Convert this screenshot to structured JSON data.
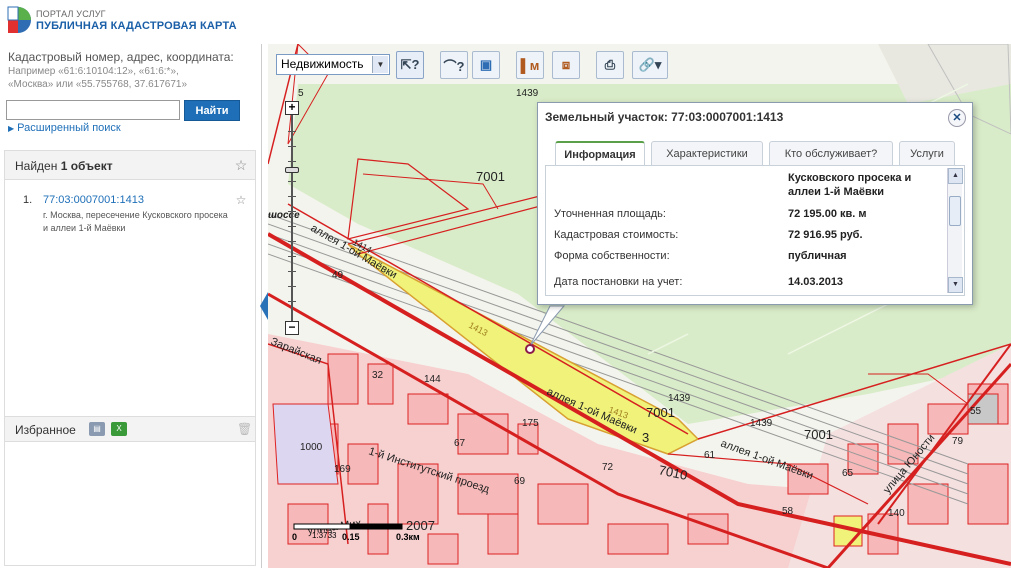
{
  "header": {
    "portal_title": "ПОРТАЛ УСЛУГ",
    "portal_subtitle": "ПУБЛИЧНАЯ КАДАСТРОВАЯ КАРТА"
  },
  "search": {
    "label": "Кадастровый номер, адрес, координата:",
    "example_line1": "Например «61:6:10104:12», «61:6:*»,",
    "example_line2": "«Москва» или «55.755768, 37.617671»",
    "input_value": "",
    "button_label": "Найти",
    "advanced_label": "Расширенный поиск"
  },
  "results": {
    "found_prefix": "Найден ",
    "found_count": "1 объект",
    "items": [
      {
        "number": "1.",
        "cadastral_number": "77:03:0007001:1413",
        "address": "г. Москва, пересечение Кусковского просека и аллеи 1-й Маёвки"
      }
    ]
  },
  "favorites": {
    "label": "Избранное"
  },
  "toolbar": {
    "layer_select": "Недвижимость"
  },
  "popup": {
    "title": "Земельный участок: 77:03:0007001:1413",
    "tabs": [
      "Информация",
      "Характеристики",
      "Кто обслуживает?",
      "Услуги"
    ],
    "active_tab": "Информация",
    "address_line1": "Кусковского просека и",
    "address_line2": "аллеи 1-й Маёвки",
    "rows": [
      {
        "label": "Уточненная площадь:",
        "value": "72 195.00 кв. м"
      },
      {
        "label": "Кадастровая стоимость:",
        "value": "72 916.95 руб."
      },
      {
        "label": "Форма собственности:",
        "value": "публичная"
      },
      {
        "label": "Дата постановки на учет:",
        "value": "14.03.2013"
      }
    ]
  },
  "scale": {
    "labels": [
      "0",
      "0.15",
      "0.3км"
    ],
    "ratio": "1:3733"
  },
  "map_labels": {
    "parcel_1439_top": "1439",
    "parcel_7001_a": "7001",
    "parcel_1414": "1414",
    "road_49": "49",
    "parcel_1413_a": "1413",
    "parcel_1413_b": "1413",
    "parcel_7001_b": "7001",
    "num_3": "3",
    "parcel_1439_b": "1439",
    "parcel_1439_c": "1439",
    "parcel_7001_c": "7001",
    "parcel_7010": "7010",
    "alley_name_1": "аллея 1-ой Маёвки",
    "alley_name_2": "аллея 1-ой Маёвки",
    "alley_name_3": "аллея 1-ой Маёвки",
    "street_zarayskaya": "Зарайская",
    "street_institutsky": "1-й Институтский проезд",
    "street_yunosti": "улица Юности",
    "street_miv": "улица Мих",
    "area_name": "шоссе",
    "num_5": "5",
    "num_144": "144",
    "num_32": "32",
    "num_175": "175",
    "num_67": "67",
    "num_1000": "1000",
    "num_169": "169",
    "num_69": "69",
    "num_72": "72",
    "num_2007": "2007",
    "num_79": "79",
    "num_55": "55",
    "num_140": "140",
    "num_58": "58",
    "num_61": "61",
    "num_65": "65"
  },
  "colors": {
    "brand": "#1e6fb8",
    "parcel_border": "#d62020",
    "parcel_fill": "#f8c8c8",
    "selected_fill": "#f0f27a",
    "park": "#d8ecc8"
  }
}
